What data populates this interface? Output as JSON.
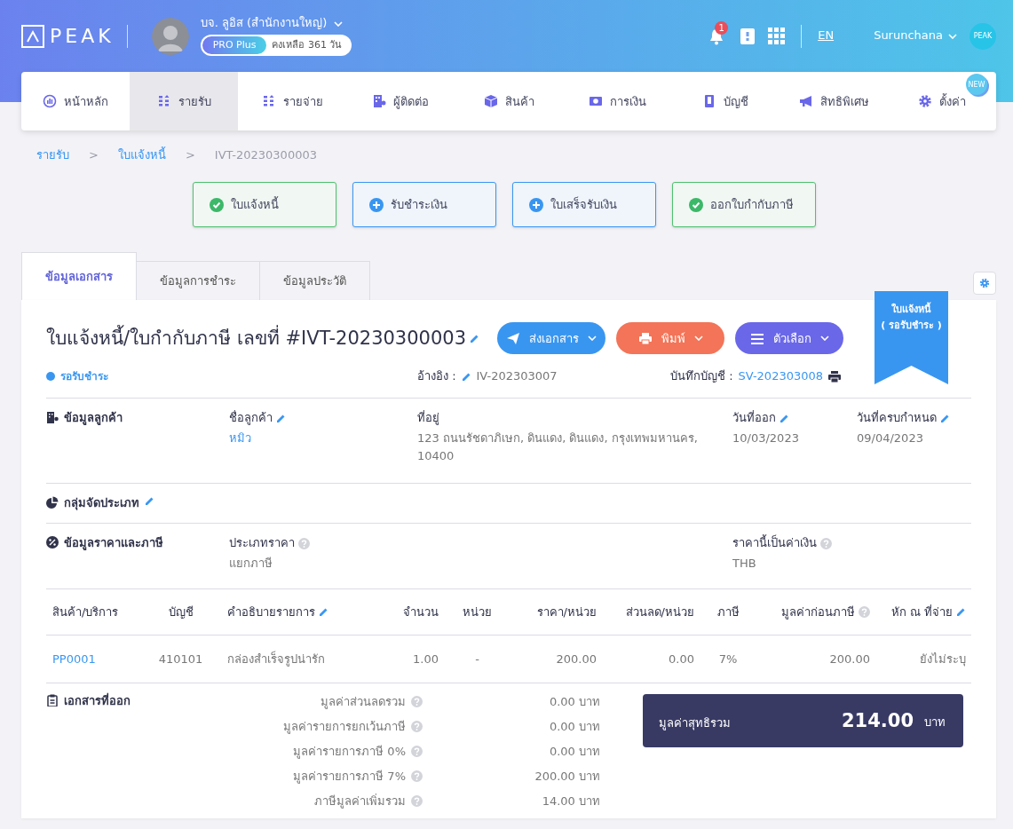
{
  "header": {
    "logo": "PEAK",
    "company": "บจ. ลูอิส (สำนักงานใหญ่)",
    "plan": "PRO Plus",
    "remaining": "คงเหลือ 361 วัน",
    "notifications": "1",
    "language": "EN",
    "user": "Surunchana",
    "user_avatar": "PEAK"
  },
  "nav": [
    {
      "label": "หน้าหลัก",
      "selected": false
    },
    {
      "label": "รายรับ",
      "selected": true
    },
    {
      "label": "รายจ่าย",
      "selected": false
    },
    {
      "label": "ผู้ติดต่อ",
      "selected": false
    },
    {
      "label": "สินค้า",
      "selected": false
    },
    {
      "label": "การเงิน",
      "selected": false
    },
    {
      "label": "บัญชี",
      "selected": false
    },
    {
      "label": "สิทธิพิเศษ",
      "selected": false
    },
    {
      "label": "ตั้งค่า",
      "selected": false,
      "badge": "NEW"
    }
  ],
  "breadcrumb": [
    {
      "kind": "link",
      "label": "รายรับ"
    },
    {
      "kind": "sep",
      "label": ">"
    },
    {
      "kind": "link",
      "label": "ใบแจ้งหนี้"
    },
    {
      "kind": "sep",
      "label": ">"
    },
    {
      "kind": "current",
      "label": "IVT-20230300003"
    }
  ],
  "steps": [
    {
      "label": "ใบแจ้งหนี้",
      "done": true
    },
    {
      "label": "รับชำระเงิน",
      "done": false
    },
    {
      "label": "ใบเสร็จรับเงิน",
      "done": false
    },
    {
      "label": "ออกใบกำกับภาษี",
      "done": true
    }
  ],
  "tabs": [
    {
      "label": "ข้อมูลเอกสาร",
      "selected": true
    },
    {
      "label": "ข้อมูลการชำระ",
      "selected": false
    },
    {
      "label": "ข้อมูลประวัติ",
      "selected": false
    }
  ],
  "document": {
    "title": "ใบแจ้งหนี้/ใบกำกับภาษี เลขที่ #IVT-20230300003",
    "buttons": [
      {
        "kind": "send",
        "label": "ส่งเอกสาร"
      },
      {
        "kind": "print",
        "label": "พิมพ์"
      },
      {
        "kind": "options",
        "label": "ตัวเลือก"
      }
    ],
    "ribbon": [
      "ใบแจ้งหนี้",
      "( รอรับชำระ )"
    ],
    "status": "รอรับชำระ",
    "reference_label": "อ้างอิง :",
    "reference": "IV-202303007",
    "journal_label": "บันทึกบัญชี :",
    "journal": "SV-202303008"
  },
  "customer": {
    "heading": "ข้อมูลลูกค้า",
    "fields": [
      {
        "label": "ชื่อลูกค้า",
        "value": "หมิว",
        "link": true
      },
      {
        "label": "ที่อยู่",
        "value": "123 ถนนรัชดาภิเษก, ดินแดง, ดินแดง, กรุงเทพมหานคร, 10400",
        "link": false
      },
      {
        "label": "วันที่ออก",
        "value": "10/03/2023",
        "link": false
      },
      {
        "label": "วันที่ครบกำหนด",
        "value": "09/04/2023",
        "link": false
      }
    ]
  },
  "category": {
    "heading": "กลุ่มจัดประเภท"
  },
  "pricing": {
    "heading": "ข้อมูลราคาและภาษี",
    "price_type_label": "ประเภทราคา",
    "price_type": "แยกภาษี",
    "currency_label": "ราคานี้เป็นค่าเงิน",
    "currency": "THB"
  },
  "table": {
    "columns": [
      {
        "label": "สินค้า/บริการ"
      },
      {
        "label": "บัญชี"
      },
      {
        "label": "คำอธิบายรายการ",
        "edit": true
      },
      {
        "label": "จำนวน"
      },
      {
        "label": "หน่วย"
      },
      {
        "label": "ราคา/หน่วย"
      },
      {
        "label": "ส่วนลด/หน่วย"
      },
      {
        "label": "ภาษี"
      },
      {
        "label": "มูลค่าก่อนภาษี",
        "help": true
      },
      {
        "label": "หัก ณ ที่จ่าย",
        "edit": true
      }
    ],
    "rows": [
      [
        "PP0001",
        "410101",
        "กล่องสำเร็จรูปน่ารัก",
        "1.00",
        "-",
        "200.00",
        "0.00",
        "7%",
        "200.00",
        "ยังไม่ระบุ"
      ]
    ]
  },
  "summary": {
    "heading": "เอกสารที่ออก",
    "lines": [
      {
        "label": "มูลค่าส่วนลดรวม",
        "value": "0.00 บาท"
      },
      {
        "label": "มูลค่ารายการยกเว้นภาษี",
        "value": "0.00 บาท"
      },
      {
        "label": "มูลค่ารายการภาษี 0%",
        "value": "0.00 บาท"
      },
      {
        "label": "มูลค่ารายการภาษี 7%",
        "value": "200.00 บาท"
      },
      {
        "label": "ภาษีมูลค่าเพิ่มรวม",
        "value": "14.00 บาท"
      }
    ],
    "total_label": "มูลค่าสุทธิรวม",
    "total": "214.00",
    "total_unit": "บาท"
  }
}
